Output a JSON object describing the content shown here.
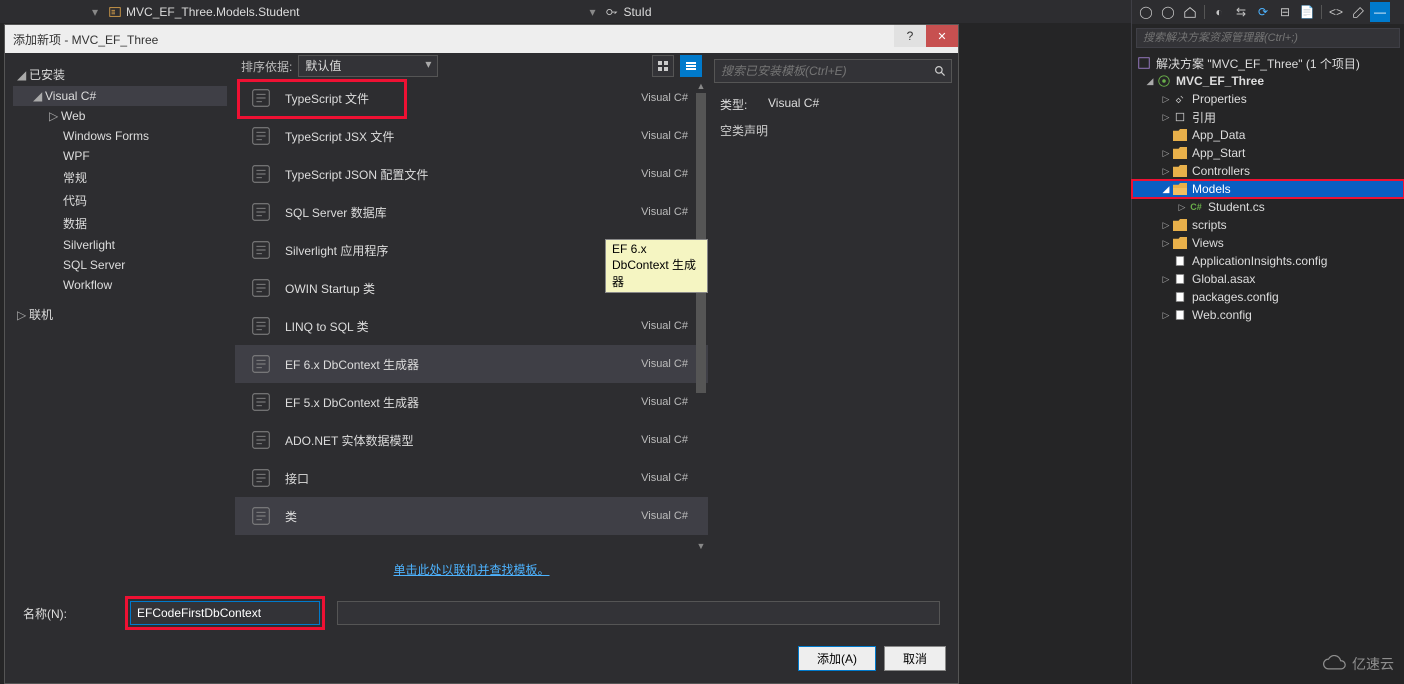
{
  "breadcrumb": {
    "class": "MVC_EF_Three.Models.Student",
    "member": "StuId"
  },
  "dialog": {
    "title": "添加新项 - MVC_EF_Three",
    "help": "?",
    "close": "✕",
    "left": {
      "installed": "已安装",
      "visual_csharp": "Visual C#",
      "web": "Web",
      "windows_forms": "Windows Forms",
      "wpf": "WPF",
      "general": "常规",
      "code": "代码",
      "data": "数据",
      "silverlight": "Silverlight",
      "sql_server": "SQL Server",
      "workflow": "Workflow",
      "online": "联机"
    },
    "sort_label": "排序依据:",
    "sort_value": "默认值",
    "templates": [
      {
        "name": "类",
        "lang": "Visual C#",
        "selected": true,
        "highlight": true
      },
      {
        "name": "接口",
        "lang": "Visual C#"
      },
      {
        "name": "ADO.NET 实体数据模型",
        "lang": "Visual C#"
      },
      {
        "name": "EF 5.x DbContext 生成器",
        "lang": "Visual C#"
      },
      {
        "name": "EF 6.x DbContext 生成器",
        "lang": "Visual C#",
        "hovered": true
      },
      {
        "name": "LINQ to SQL 类",
        "lang": "Visual C#"
      },
      {
        "name": "OWIN Startup 类",
        "lang": "Visual C#"
      },
      {
        "name": "Silverlight 应用程序",
        "lang": "Visual C#"
      },
      {
        "name": "SQL Server 数据库",
        "lang": "Visual C#"
      },
      {
        "name": "TypeScript JSON 配置文件",
        "lang": "Visual C#"
      },
      {
        "name": "TypeScript JSX 文件",
        "lang": "Visual C#"
      },
      {
        "name": "TypeScript 文件",
        "lang": "Visual C#"
      }
    ],
    "tooltip": "EF 6.x DbContext 生成器",
    "online_link": "单击此处以联机并查找模板。",
    "search_placeholder": "搜索已安装模板(Ctrl+E)",
    "details": {
      "type_label": "类型:",
      "type_value": "Visual C#",
      "desc": "空类声明"
    },
    "name_label": "名称(N):",
    "name_value": "EFCodeFirstDbContext",
    "add_btn": "添加(A)",
    "cancel_btn": "取消"
  },
  "explorer": {
    "search_placeholder": "搜索解决方案资源管理器(Ctrl+;)",
    "solution": "解决方案 \"MVC_EF_Three\" (1 个项目)",
    "project": "MVC_EF_Three",
    "properties": "Properties",
    "references": "引用",
    "app_data": "App_Data",
    "app_start": "App_Start",
    "controllers": "Controllers",
    "models": "Models",
    "student": "Student.cs",
    "scripts": "scripts",
    "views": "Views",
    "appinsights": "ApplicationInsights.config",
    "globalasax": "Global.asax",
    "packages": "packages.config",
    "webconfig": "Web.config"
  },
  "watermark": "亿速云"
}
